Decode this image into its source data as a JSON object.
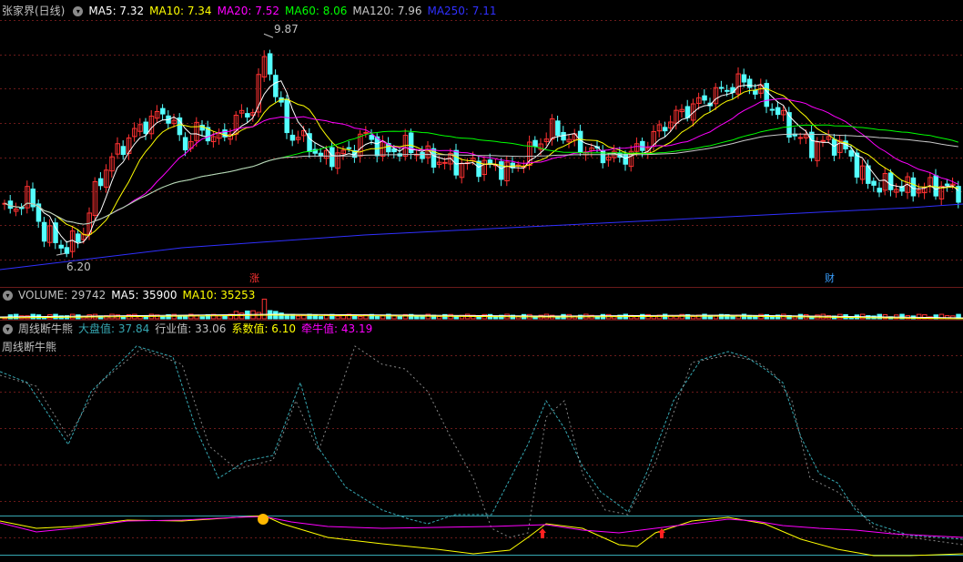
{
  "main_header": {
    "title": "张家界(日线)",
    "ma5": "MA5: 7.32",
    "ma10": "MA10: 7.34",
    "ma20": "MA20: 7.52",
    "ma60": "MA60: 8.06",
    "ma120": "MA120: 7.96",
    "ma250": "MA250: 7.11"
  },
  "colors": {
    "ma5": "#ffffff",
    "ma10": "#ffff00",
    "ma20": "#ff00ff",
    "ma60": "#00ff00",
    "ma120": "#c8c8c8",
    "ma250": "#3030ff",
    "up": "#ff3232",
    "down": "#54ffff",
    "grid": "#6a1a1a",
    "volume_ma5": "#ffffff",
    "volume_ma10": "#ffff00",
    "osc_dapan": "#36a7b2",
    "osc_hangye": "#c0c0c0",
    "osc_xishu": "#ffff00",
    "osc_qianniu": "#ff00ff"
  },
  "volume_header": {
    "label": "VOLUME: 29742",
    "ma5": "MA5: 35900",
    "ma10": "MA10: 35253"
  },
  "osc_header": {
    "name": "周线断牛熊",
    "dapan": "大盘值: 37.84",
    "hangye": "行业值: 33.06",
    "xishu": "系数值: 6.10",
    "qianniu": "牵牛值: 43.19"
  },
  "osc_title": "周线断牛熊",
  "chart_data": {
    "type": "candlestick",
    "annotations": {
      "high": "9.87",
      "low": "6.20",
      "marker_left": "涨",
      "marker_right": "财"
    },
    "price_range": [
      5.9,
      10.1
    ],
    "ma_latest": {
      "MA5": 7.32,
      "MA10": 7.34,
      "MA20": 7.52,
      "MA60": 8.06,
      "MA120": 7.96,
      "MA250": 7.11
    },
    "volume_latest": {
      "VOLUME": 29742,
      "MA5": 35900,
      "MA10": 35253
    },
    "oscillator_latest": {
      "大盘值": 37.84,
      "行业值": 33.06,
      "系数值": 6.1,
      "牵牛值": 43.19
    }
  }
}
